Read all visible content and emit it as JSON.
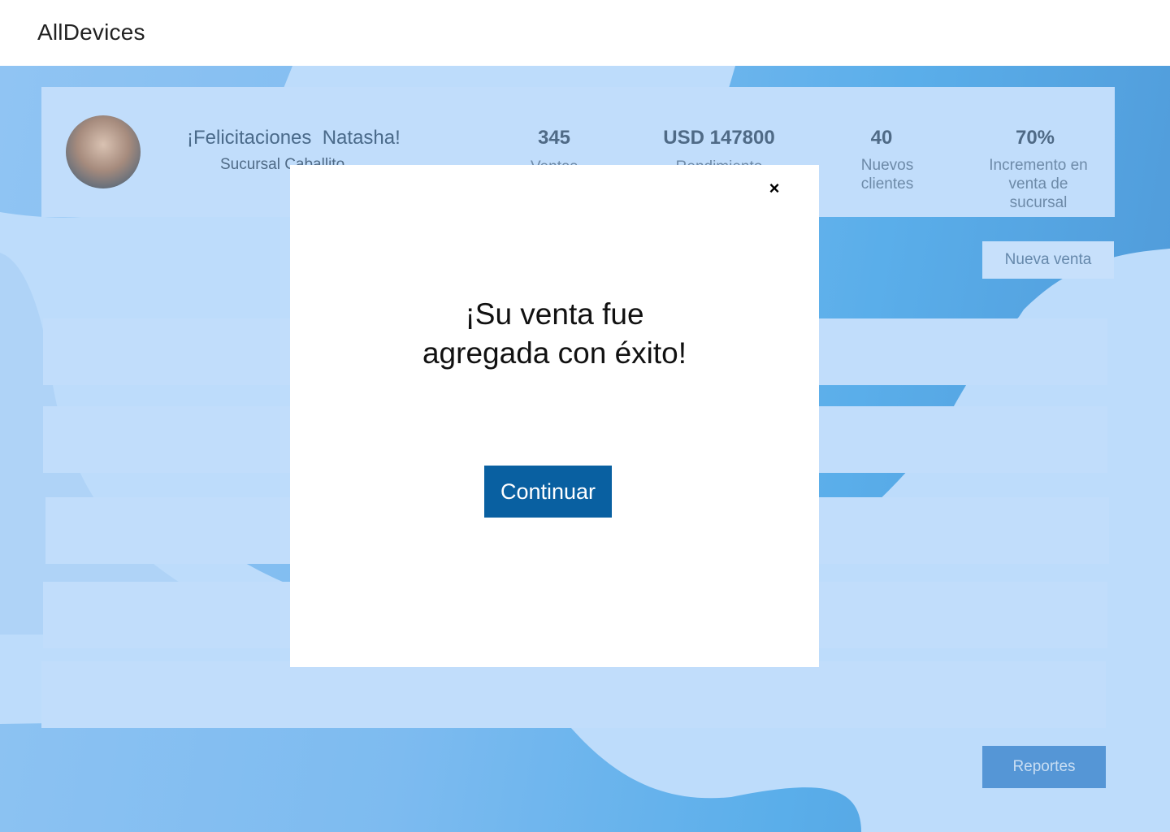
{
  "app": {
    "title": "AllDevices"
  },
  "summary": {
    "greeting": "¡Felicitaciones  Natasha!",
    "branch": "Sucursal Caballito",
    "stats": [
      {
        "value": "345",
        "label": "Ventas"
      },
      {
        "value": "USD 147800",
        "label": "Rendimiento"
      },
      {
        "value": "40",
        "label": "Nuevos clientes"
      },
      {
        "value": "70%",
        "label": "Incremento en venta de sucursal"
      }
    ]
  },
  "actions": {
    "new_sale": "Nueva venta",
    "reports": "Reportes"
  },
  "modal": {
    "close_icon": "×",
    "title_line1": "¡Su venta fue",
    "title_line2": "agregada con éxito!",
    "continue": "Continuar"
  },
  "colors": {
    "accent": "#0960a1",
    "card": "#c1ddfb",
    "background": "#5aaeea"
  }
}
